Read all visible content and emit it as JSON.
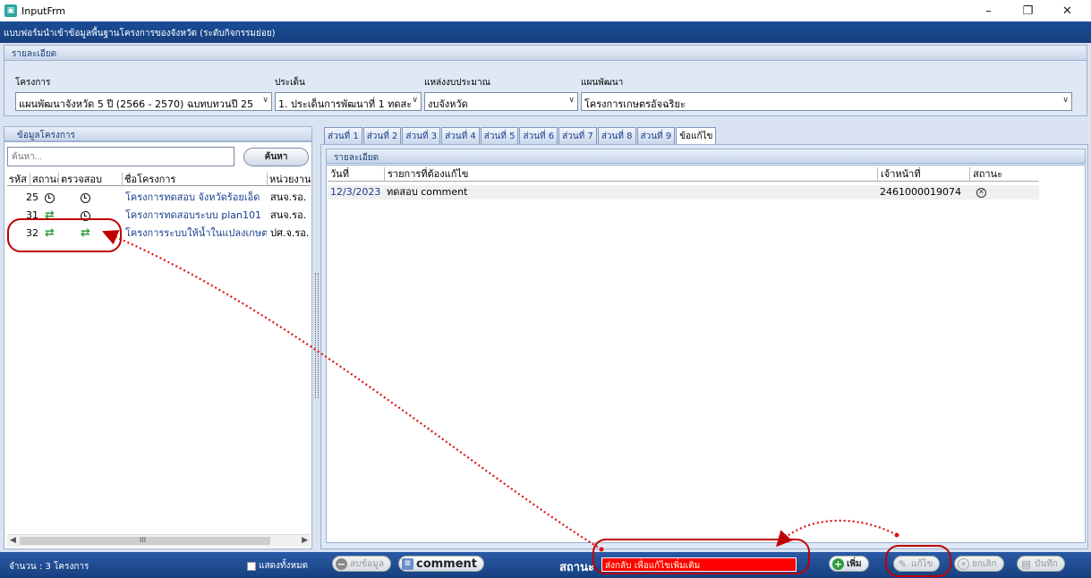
{
  "window": {
    "title": "InputFrm",
    "minimize": "–",
    "restore": "❐",
    "close": "✕"
  },
  "form_title": "แบบฟอร์มนำเข้าข้อมูลพื้นฐานโครงการของจังหวัด (ระดับกิจกรรมย่อย)",
  "detail_header": "รายละเอียด",
  "filters": {
    "project_label": "โครงการ",
    "project_value": "แผนพัฒนาจังหวัด 5 ปี (2566 - 2570) ฉบทบทวนปี 25",
    "issue_label": "ประเด็น",
    "issue_value": "1. ประเด็นการพัฒนาที่ 1 ทดสะ",
    "budget_label": "แหล่งงบประมาณ",
    "budget_value": "งบจังหวัด",
    "plan_label": "แผนพัฒนา",
    "plan_value": "โครงการเกษตรอัจฉริยะ"
  },
  "left_panel": {
    "header": "ข้อมูลโครงการ",
    "search_placeholder": "ค้นหา...",
    "search_button": "ค้นหา",
    "columns": [
      "รหัส",
      "สถานะ",
      "ตรวจสอบ",
      "ชื่อโครงการ",
      "หน่วยงาน"
    ],
    "rows": [
      {
        "id": "25",
        "status_icon": "clock-icon",
        "check_icon": "clock-icon",
        "name": "โครงการทดสอบ จังหวัดร้อยเอ็ด",
        "unit": "สนจ.รอ."
      },
      {
        "id": "31",
        "status_icon": "sync-icon",
        "check_icon": "clock-icon",
        "name": "โครงการทดสอบระบบ plan101",
        "unit": "สนจ.รอ."
      },
      {
        "id": "32",
        "status_icon": "sync-icon",
        "check_icon": "sync-icon",
        "name": "โครงการระบบให้น้ำในแปลงเกษตร",
        "unit": "ปศ.จ.รอ."
      }
    ],
    "scroll_marker": "III"
  },
  "tabs": [
    "ส่วนที่ 1",
    "ส่วนที่ 2",
    "ส่วนที่ 3",
    "ส่วนที่ 4",
    "ส่วนที่ 5",
    "ส่วนที่ 6",
    "ส่วนที่ 7",
    "ส่วนที่ 8",
    "ส่วนที่ 9",
    "ข้อแก้ไข"
  ],
  "active_tab": "ข้อแก้ไข",
  "right_panel": {
    "header": "รายละเอียด",
    "columns": [
      "วันที่",
      "รายการที่ต้องแก้ไข",
      "เจ้าหน้าที่",
      "สถานะ"
    ],
    "rows": [
      {
        "date": "12/3/2023",
        "item": "ทดสอบ comment",
        "officer": "2461000019074",
        "status_icon": "cancel-circle-icon"
      }
    ]
  },
  "bottom": {
    "count_label": "จำนวน : 3 โครงการ",
    "show_all": "แสดงทั้งหมด",
    "delete_button": "ลบข้อมูล",
    "comment_button": "comment",
    "status_label": "สถานะ",
    "status_value": "ส่งกลับ เพื่อแก้ไขเพิ่มเติม",
    "add_button": "เพิ่ม",
    "edit_button": "แก้ไข",
    "cancel_button": "ยกเลิก",
    "save_button": "บันทึก"
  },
  "colors": {
    "title_bar": "#17407f",
    "status_box": "#ff0000",
    "annotation": "#c00000",
    "sync_icon": "#2e9b3a"
  }
}
